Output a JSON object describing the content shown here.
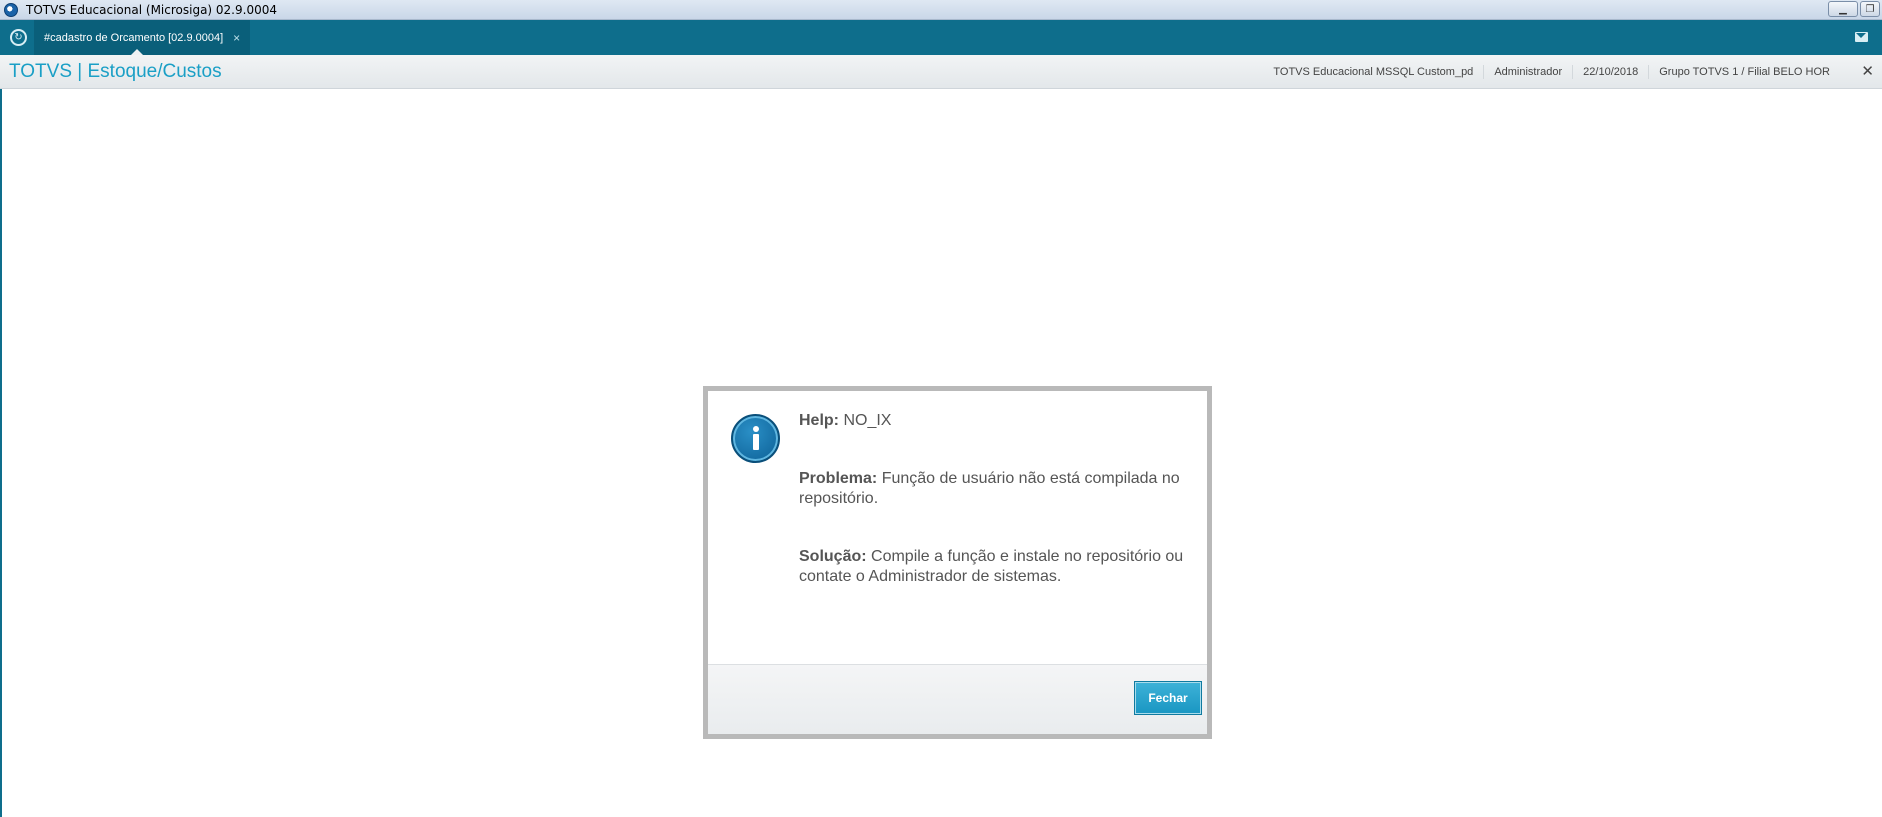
{
  "window": {
    "title": "TOTVS Educacional (Microsiga) 02.9.0004",
    "controls": [
      "minimize",
      "restore"
    ]
  },
  "tabbar": {
    "menu_icon": "refresh-circle-icon",
    "tab_label": "#cadastro de Orcamento [02.9.0004]",
    "tab_close": "×",
    "mail_icon": "mail-icon"
  },
  "header": {
    "module_title": "TOTVS | Estoque/Custos",
    "environment": "TOTVS Educacional MSSQL Custom_pd",
    "user": "Administrador",
    "date": "22/10/2018",
    "branch": "Grupo TOTVS 1 / Filial BELO HOR",
    "close": "✕"
  },
  "dialog": {
    "icon": "info-icon",
    "help_label": "Help:",
    "help_value": "NO_IX",
    "problem_label": "Problema:",
    "problem_text": "Função de usuário não está compilada no repositório.",
    "solution_label": "Solução:",
    "solution_text": "Compile a função e instale no repositório ou contate o Administrador de sistemas.",
    "close_button": "Fechar"
  },
  "colors": {
    "tabbar_bg": "#0e6e8c",
    "accent": "#1a9fc6",
    "button_bg": "#1fa2cb"
  }
}
